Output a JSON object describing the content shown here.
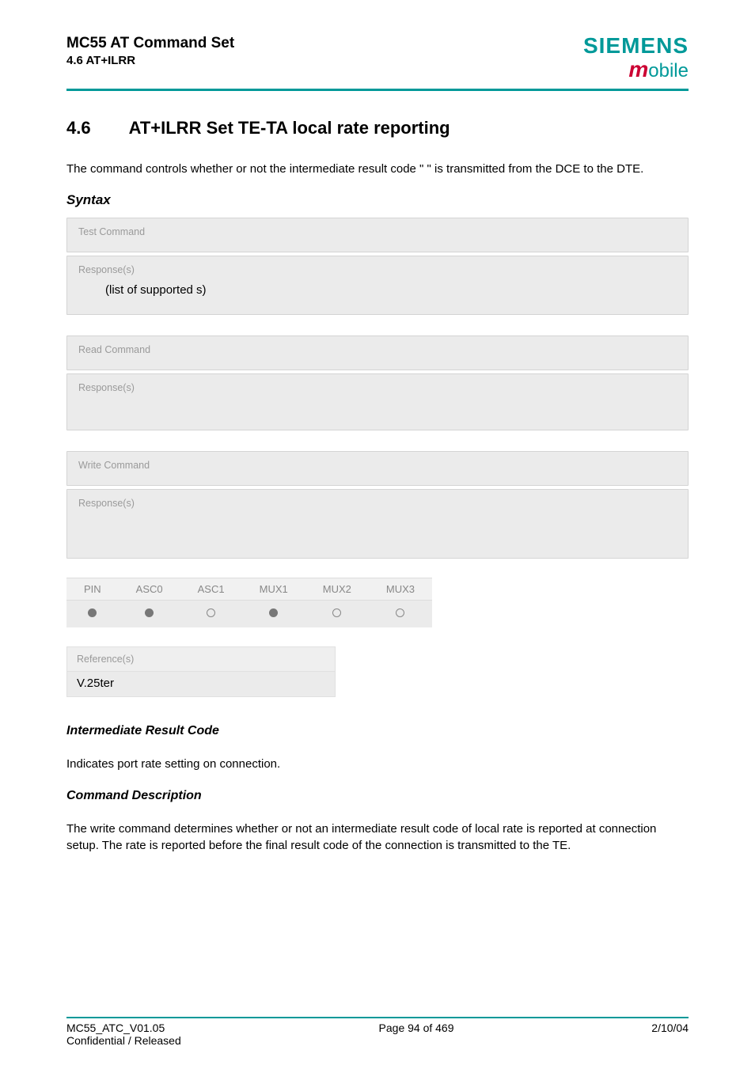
{
  "header": {
    "title": "MC55 AT Command Set",
    "subtitle": "4.6 AT+ILRR",
    "brand_main": "SIEMENS",
    "brand_sub_plain": "obile"
  },
  "section": {
    "num": "4.6",
    "title": "AT+ILRR   Set TE-TA local rate reporting"
  },
  "intro": "The command               controls whether or not the intermediate result code \"          \" is transmitted from the DCE to the DTE.",
  "syntax_label": "Syntax",
  "panels": {
    "test_label": "Test Command",
    "test_resp_label": "Response(s)",
    "test_resp_body": "(list of supported               s)",
    "read_label": "Read Command",
    "read_resp_label": "Response(s)",
    "write_label": "Write Command",
    "write_resp_label": "Response(s)"
  },
  "support": {
    "cols": [
      "PIN",
      "ASC0",
      "ASC1",
      "MUX1",
      "MUX2",
      "MUX3"
    ],
    "dots": [
      "fill",
      "fill",
      "empty",
      "fill",
      "empty",
      "empty"
    ]
  },
  "reference": {
    "label": "Reference(s)",
    "body": "V.25ter"
  },
  "irc_h": "Intermediate Result Code",
  "irc_body": "Indicates port rate setting on connection.",
  "cmddesc_h": "Command Description",
  "cmddesc_body": "The write command determines whether or not an intermediate result code of local rate is reported at connection setup. The rate is reported before the final result code of the connection is transmitted to the TE.",
  "footer": {
    "left1": "MC55_ATC_V01.05",
    "left2": "Confidential / Released",
    "center": "Page 94 of 469",
    "right": "2/10/04"
  }
}
